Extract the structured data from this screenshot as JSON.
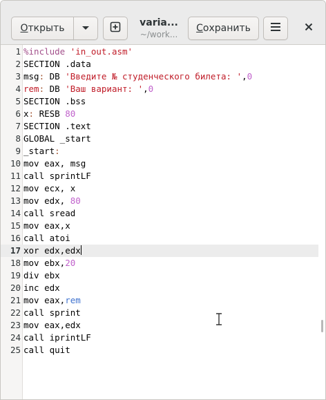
{
  "header": {
    "open_label": "Открыть",
    "save_label": "Сохранить",
    "title": "varia...",
    "subtitle": "~/work...",
    "open_arrow_icon": "chevron-down-icon",
    "new_icon": "new-tab-icon",
    "menu_icon": "hamburger-menu-icon",
    "close_icon": "close-icon"
  },
  "editor": {
    "current_line": 17,
    "lines": [
      {
        "n": "1",
        "tokens": [
          {
            "t": "%include ",
            "c": "pp"
          },
          {
            "t": "'in_out.asm'",
            "c": "str"
          }
        ]
      },
      {
        "n": "2",
        "tokens": [
          {
            "t": "SECTION .data",
            "c": ""
          }
        ]
      },
      {
        "n": "3",
        "tokens": [
          {
            "t": "msg",
            "c": ""
          },
          {
            "t": ":",
            "c": "colon"
          },
          {
            "t": " DB ",
            "c": ""
          },
          {
            "t": "'Введите № студенческого билета: '",
            "c": "str"
          },
          {
            "t": ",",
            "c": ""
          },
          {
            "t": "0",
            "c": "num"
          }
        ]
      },
      {
        "n": "4",
        "tokens": [
          {
            "t": "rem",
            "c": "red"
          },
          {
            "t": ":",
            "c": "colon"
          },
          {
            "t": " DB ",
            "c": ""
          },
          {
            "t": "'Ваш вариант: '",
            "c": "str"
          },
          {
            "t": ",",
            "c": ""
          },
          {
            "t": "0",
            "c": "num"
          }
        ]
      },
      {
        "n": "5",
        "tokens": [
          {
            "t": "SECTION .bss",
            "c": ""
          }
        ]
      },
      {
        "n": "6",
        "tokens": [
          {
            "t": "x",
            "c": ""
          },
          {
            "t": ":",
            "c": "colon"
          },
          {
            "t": " RESB ",
            "c": ""
          },
          {
            "t": "80",
            "c": "num"
          }
        ]
      },
      {
        "n": "7",
        "tokens": [
          {
            "t": "SECTION .text",
            "c": ""
          }
        ]
      },
      {
        "n": "8",
        "tokens": [
          {
            "t": "GLOBAL _start",
            "c": ""
          }
        ]
      },
      {
        "n": "9",
        "tokens": [
          {
            "t": "_start",
            "c": ""
          },
          {
            "t": ":",
            "c": "colon"
          }
        ]
      },
      {
        "n": "10",
        "tokens": [
          {
            "t": "mov eax, msg",
            "c": ""
          }
        ]
      },
      {
        "n": "11",
        "tokens": [
          {
            "t": "call sprintLF",
            "c": ""
          }
        ]
      },
      {
        "n": "12",
        "tokens": [
          {
            "t": "mov ecx, x",
            "c": ""
          }
        ]
      },
      {
        "n": "13",
        "tokens": [
          {
            "t": "mov edx, ",
            "c": ""
          },
          {
            "t": "80",
            "c": "num"
          }
        ]
      },
      {
        "n": "14",
        "tokens": [
          {
            "t": "call sread",
            "c": ""
          }
        ]
      },
      {
        "n": "15",
        "tokens": [
          {
            "t": "mov eax,x",
            "c": ""
          }
        ]
      },
      {
        "n": "16",
        "tokens": [
          {
            "t": "call atoi",
            "c": ""
          }
        ]
      },
      {
        "n": "17",
        "tokens": [
          {
            "t": "xor edx,edx",
            "c": ""
          }
        ]
      },
      {
        "n": "18",
        "tokens": [
          {
            "t": "mov ebx,",
            "c": ""
          },
          {
            "t": "20",
            "c": "num"
          }
        ]
      },
      {
        "n": "19",
        "tokens": [
          {
            "t": "div ebx",
            "c": ""
          }
        ]
      },
      {
        "n": "20",
        "tokens": [
          {
            "t": "inc edx",
            "c": ""
          }
        ]
      },
      {
        "n": "21",
        "tokens": [
          {
            "t": "mov eax,",
            "c": ""
          },
          {
            "t": "rem",
            "c": "blue"
          }
        ]
      },
      {
        "n": "22",
        "tokens": [
          {
            "t": "call sprint",
            "c": ""
          }
        ]
      },
      {
        "n": "23",
        "tokens": [
          {
            "t": "mov eax,edx",
            "c": ""
          }
        ]
      },
      {
        "n": "24",
        "tokens": [
          {
            "t": "call iprintLF",
            "c": ""
          }
        ]
      },
      {
        "n": "25",
        "tokens": [
          {
            "t": "call quit",
            "c": ""
          }
        ]
      }
    ]
  },
  "colors": {
    "headerbar_bg": "#ebebeb",
    "string": "#c01c28",
    "number": "#c061cb",
    "preprocessor": "#a3518c",
    "label": "#a0522d",
    "current_line_bg": "#ececec"
  }
}
